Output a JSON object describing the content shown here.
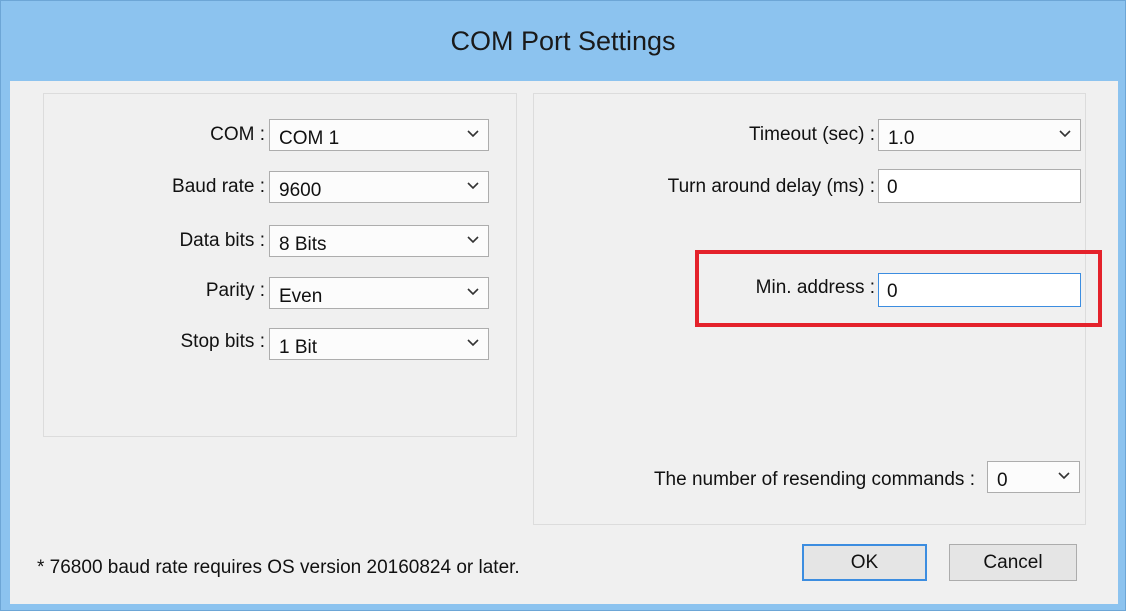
{
  "window": {
    "title": "COM Port Settings"
  },
  "left": {
    "com": {
      "label": "COM :",
      "value": "COM 1"
    },
    "baud": {
      "label": "Baud rate :",
      "value": "9600"
    },
    "data_bits": {
      "label": "Data bits :",
      "value": "8 Bits"
    },
    "parity": {
      "label": "Parity :",
      "value": "Even"
    },
    "stop_bits": {
      "label": "Stop bits :",
      "value": "1 Bit"
    }
  },
  "right": {
    "timeout": {
      "label": "Timeout (sec) :",
      "value": "1.0"
    },
    "turn_around": {
      "label": "Turn around delay (ms) :",
      "value": "0"
    },
    "min_address": {
      "label": "Min. address :",
      "value": "0"
    },
    "resend": {
      "label": "The number of resending commands :",
      "value": "0"
    }
  },
  "footer": {
    "note": "* 76800 baud rate requires OS version 20160824 or later.",
    "ok_label": "OK",
    "cancel_label": "Cancel"
  },
  "colors": {
    "titlebar": "#8cc3ef",
    "highlight": "#e4222b",
    "focus": "#3c8de0"
  },
  "icons": {
    "dropdown": "chevron-down-icon"
  }
}
